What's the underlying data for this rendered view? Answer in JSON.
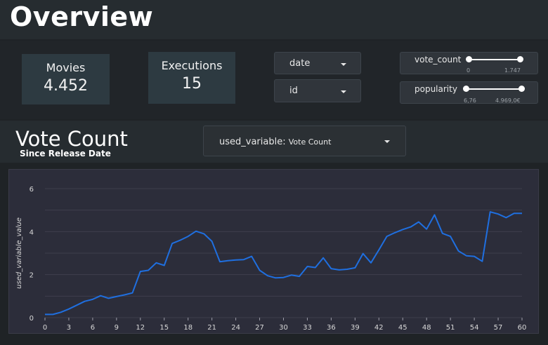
{
  "page": {
    "title": "Overview"
  },
  "stats": {
    "movies": {
      "label": "Movies",
      "value": "4.452"
    },
    "executions": {
      "label": "Executions",
      "value": "15"
    }
  },
  "filters": {
    "date": {
      "label": "date"
    },
    "id": {
      "label": "id"
    }
  },
  "sliders": {
    "vote_count": {
      "label": "vote_count",
      "min_label": "0",
      "max_label": "1.747"
    },
    "popularity": {
      "label": "popularity",
      "min_label": "6,76",
      "max_label": "4.969,0€"
    }
  },
  "section": {
    "title": "Vote Count",
    "subtitle": "Since Release Date"
  },
  "variable_select": {
    "label": "used_variable:",
    "value": "Vote Count"
  },
  "colors": {
    "line": "#1f6fe0",
    "panel": "#2c2d3a",
    "grid": "#3e3f4c"
  },
  "chart_data": {
    "type": "line",
    "title": "",
    "xlabel": "",
    "ylabel": "used_variable_value",
    "xlim": [
      0,
      60
    ],
    "ylim": [
      0,
      6
    ],
    "x_ticks": [
      0,
      3,
      6,
      9,
      12,
      15,
      18,
      21,
      24,
      27,
      30,
      33,
      36,
      39,
      42,
      45,
      48,
      51,
      54,
      57,
      60
    ],
    "y_ticks": [
      0,
      2,
      4,
      6
    ],
    "grid": true,
    "series": [
      {
        "x": [
          0,
          1,
          2,
          3,
          4,
          5,
          6,
          7,
          8,
          9,
          10,
          11,
          12,
          13,
          14,
          15,
          16,
          17,
          18,
          19,
          20,
          21,
          22,
          23,
          24,
          25,
          26,
          27,
          28,
          29,
          30,
          31,
          32,
          33,
          34,
          35,
          36,
          37,
          38,
          39,
          40,
          41,
          42,
          43,
          44,
          45,
          46,
          47,
          48,
          49,
          50,
          51,
          52,
          53,
          54,
          55,
          56,
          57,
          58,
          59,
          60
        ],
        "values": [
          0.15,
          0.15,
          0.25,
          0.4,
          0.58,
          0.76,
          0.85,
          1.02,
          0.9,
          0.98,
          1.06,
          1.15,
          2.15,
          2.2,
          2.55,
          2.43,
          3.45,
          3.6,
          3.78,
          4.02,
          3.9,
          3.55,
          2.6,
          2.65,
          2.68,
          2.7,
          2.85,
          2.2,
          1.95,
          1.85,
          1.87,
          1.98,
          1.92,
          2.38,
          2.33,
          2.78,
          2.28,
          2.22,
          2.25,
          2.32,
          2.98,
          2.55,
          3.15,
          3.78,
          3.95,
          4.1,
          4.22,
          4.45,
          4.12,
          4.78,
          3.92,
          3.78,
          3.1,
          2.88,
          2.85,
          2.62,
          4.92,
          4.82,
          4.65,
          4.85,
          4.85
        ]
      }
    ]
  }
}
